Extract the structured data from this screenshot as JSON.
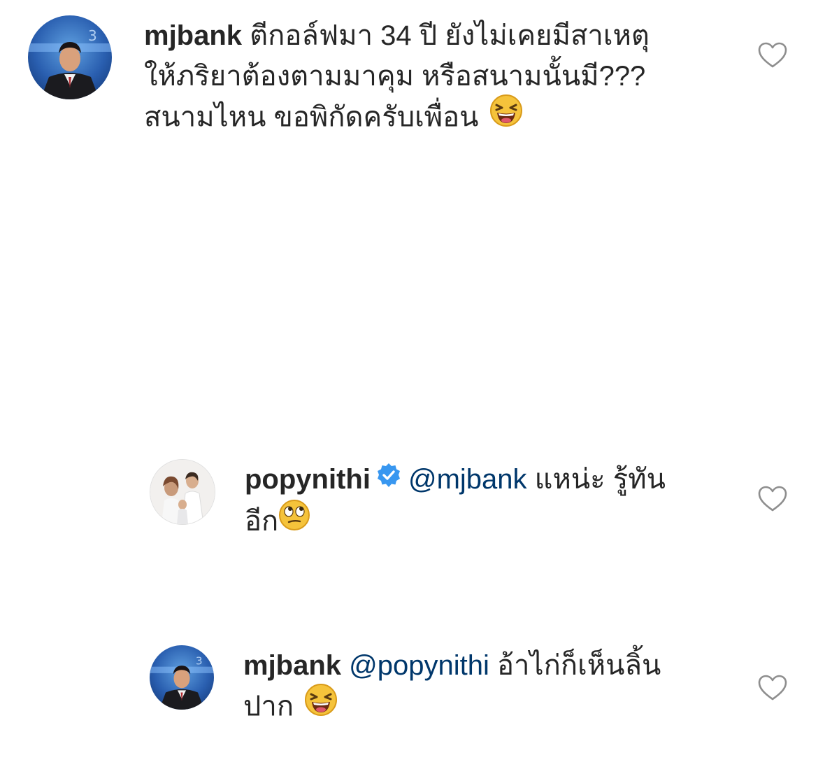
{
  "comments": [
    {
      "username": "mjbank",
      "verified": false,
      "lines": [
        "ตีกอล์ฟมา 34 ปี ยังไม่เคยมีสาเหตุ",
        "ให้ภริยาต้องตามมาคุม หรือสนามนั้นมี???",
        "สนามไหน ขอพิกัดครับเพื่อน"
      ],
      "emoji": "laughing-face",
      "avatar": "mjbank-avatar-icon",
      "like_icon": "heart-icon"
    },
    {
      "username": "popynithi",
      "verified": true,
      "mention": "@mjbank",
      "lines": [
        "แหน่ะ รู้ทัน",
        "อีก"
      ],
      "emoji": "rolling-eyes-face",
      "avatar": "popynithi-avatar-icon",
      "like_icon": "heart-icon"
    },
    {
      "username": "mjbank",
      "verified": false,
      "mention": "@popynithi",
      "lines": [
        "อ้าไก่ก็เห็นลิ้น",
        "ปาก"
      ],
      "emoji": "laughing-face",
      "avatar": "mjbank-avatar-icon",
      "like_icon": "heart-icon"
    }
  ],
  "colors": {
    "text": "#262626",
    "mention": "#00376b",
    "verified_badge": "#3897f0",
    "heart_outline": "#8e8e8e",
    "emoji_face": "#f5c33b"
  }
}
